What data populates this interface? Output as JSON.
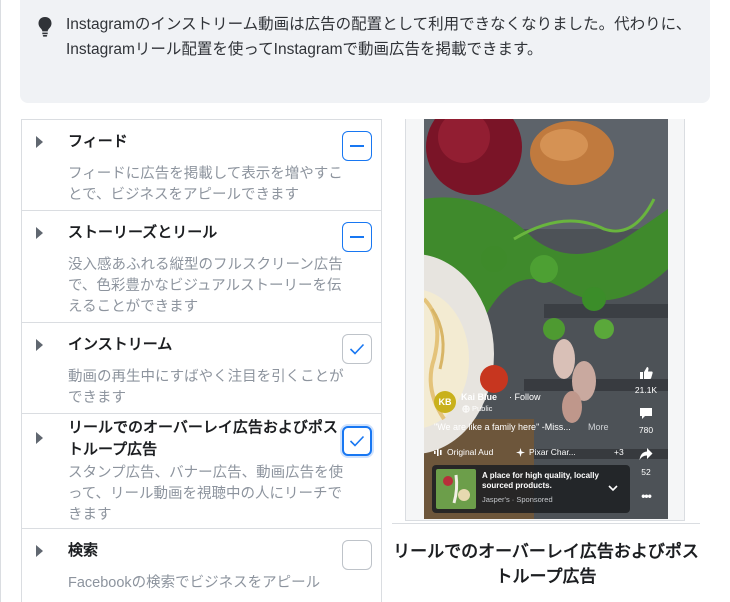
{
  "notice": {
    "icon": "lightbulb-icon",
    "text": "Instagramのインストリーム動画は広告の配置として利用できなくなりました。代わりに、Instagramリール配置を使ってInstagramで動画広告を掲載できます。"
  },
  "placements": [
    {
      "title": "フィード",
      "description": "フィードに広告を掲載して表示を増やすことで、ビジネスをアピールできます",
      "state": "partial"
    },
    {
      "title": "ストーリーズとリール",
      "description": "没入感あふれる縦型のフルスクリーン広告で、色彩豊かなビジュアルストーリーを伝えることができます",
      "state": "partial"
    },
    {
      "title": "インストリーム",
      "description": "動画の再生中にすばやく注目を引くことができます",
      "state": "checked"
    },
    {
      "title": "リールでのオーバーレイ広告およびポストループ広告",
      "description": "スタンプ広告、バナー広告、動画広告を使って、リール動画を視聴中の人にリーチできます",
      "state": "checked-focused"
    },
    {
      "title": "検索",
      "description": "Facebookの検索でビジネスをアピール",
      "state": "unchecked"
    }
  ],
  "preview": {
    "caption": "リールでのオーバーレイ広告およびポストループ広告",
    "avatar_initials": "KB",
    "account_name": "Kai Blue",
    "follow_label": "· Follow",
    "visibility": "Public",
    "post_caption": "\"We are like a family here\" -Miss...",
    "more_label": "More",
    "audio_label": "Original Aud",
    "effect_label": "Pixar Char...",
    "extra_count": "+3",
    "likes": "21.1K",
    "comments": "780",
    "shares": "52",
    "ad_headline": "A place for high quality, locally sourced products.",
    "ad_sponsor": "Jasper's · Sponsored"
  },
  "colors": {
    "accent": "#1877f2",
    "border": "#dadde1",
    "muted": "#8d949e",
    "banner": "#f0f2f5",
    "avatar": "#c9b11c"
  }
}
